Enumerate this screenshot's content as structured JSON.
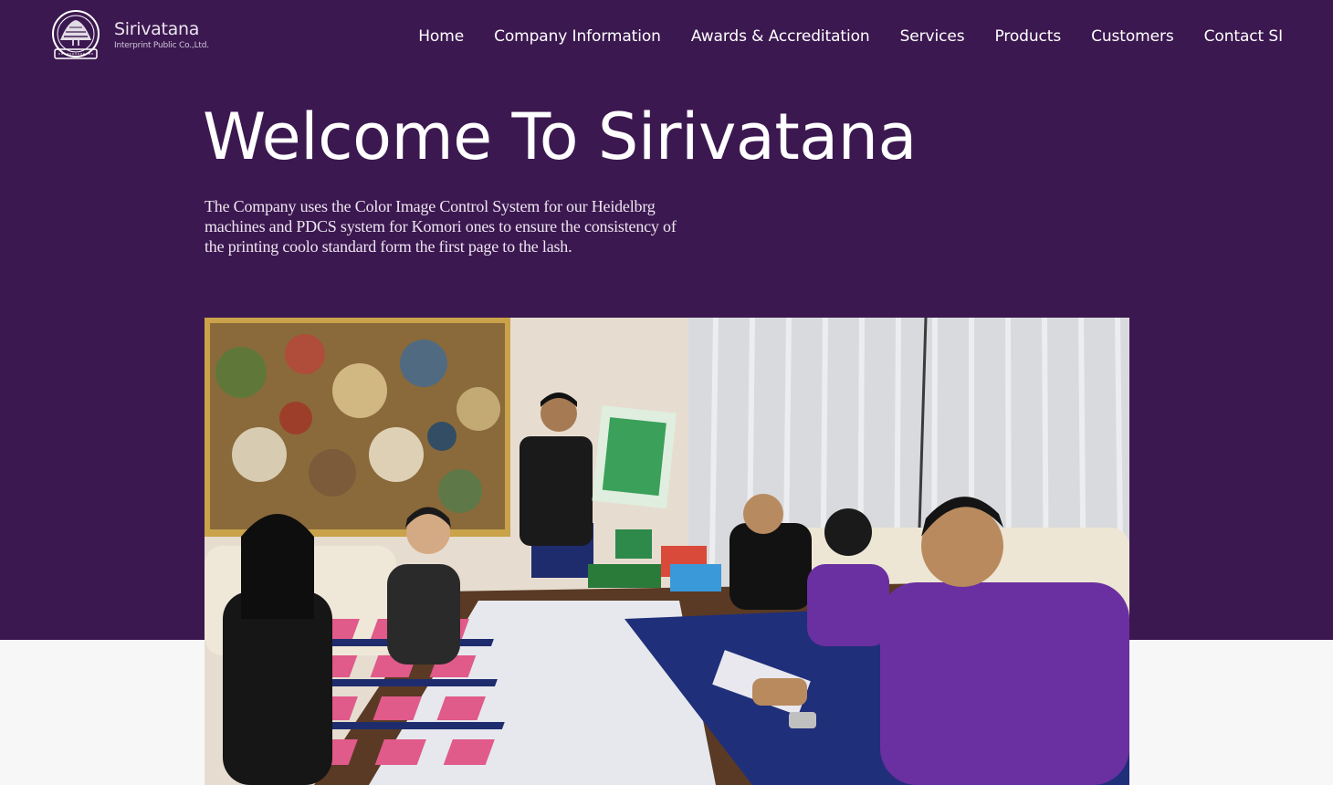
{
  "brand": {
    "name": "Sirivatana",
    "subtitle": "Interprint Public Co.,Ltd."
  },
  "nav": {
    "items": [
      {
        "label": "Home"
      },
      {
        "label": "Company Information"
      },
      {
        "label": "Awards & Accreditation"
      },
      {
        "label": "Services"
      },
      {
        "label": "Products"
      },
      {
        "label": "Customers"
      },
      {
        "label": "Contact SI"
      }
    ]
  },
  "hero": {
    "title": "Welcome To Sirivatana",
    "description": "The Company uses the Color Image Control System for our Heidelbrg machines and PDCS system for Komori ones to ensure the consistency of the printing coolo standard form the first page to the lash."
  },
  "colors": {
    "hero_background": "#3c1850",
    "page_background": "#f7f7f8",
    "nav_text": "#ffffff",
    "accent_purple": "#6a2fa0"
  }
}
